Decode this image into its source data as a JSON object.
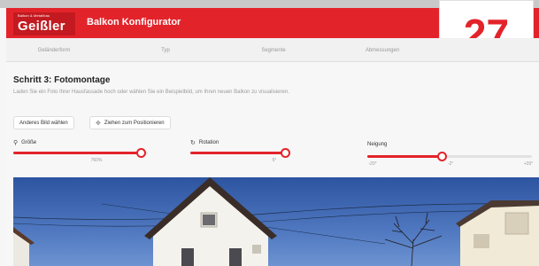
{
  "header": {
    "logo_small": "Balkon & Metallbau",
    "logo_main": "Geißler",
    "title": "Balkon Konfigurator",
    "badge_number": "27",
    "brand_color": "#e3232a"
  },
  "steps": [
    {
      "label": "Geländerform"
    },
    {
      "label": "Typ"
    },
    {
      "label": "Segmente"
    },
    {
      "label": "Abmessungen"
    }
  ],
  "section": {
    "title": "Schritt 3: Fotomontage",
    "description": "Laden Sie ein Foto Ihrer Hausfassade hoch oder wählen Sie ein Beispielbild, um Ihren neuen Balkon zu visualisieren."
  },
  "buttons": {
    "change_image": "Anderes Bild wählen",
    "drag_to_position": "Ziehen zum Positionieren",
    "drag_icon": "move-icon"
  },
  "controls": {
    "size": {
      "label": "Größe",
      "icon": "zoom-icon",
      "value_label": "760%",
      "level": 0.95
    },
    "rotation": {
      "label": "Rotation",
      "icon": "rotate-icon",
      "value_label": "5°",
      "level": 0.99
    },
    "tilt": {
      "label": "Neigung",
      "min_label": "-20°",
      "value_label": "-2°",
      "max_label": "+20°",
      "level": 0.45
    }
  }
}
